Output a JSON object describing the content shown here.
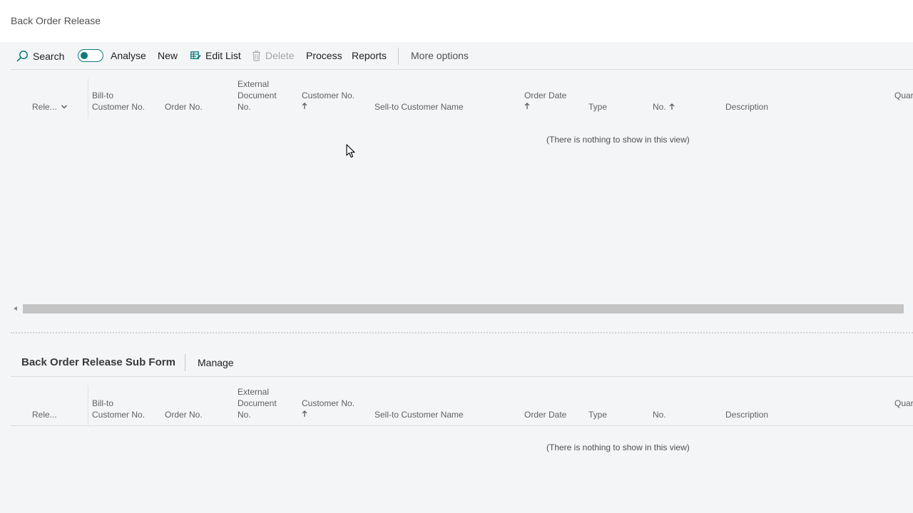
{
  "page": {
    "title": "Back Order Release"
  },
  "actions": {
    "search": "Search",
    "analyse": "Analyse",
    "new": "New",
    "edit_list": "Edit List",
    "delete": "Delete",
    "process": "Process",
    "reports": "Reports",
    "more_options": "More options"
  },
  "main_grid": {
    "columns": {
      "released": "Rele...",
      "bill_to_line1": "Bill-to",
      "bill_to_line2": "Customer No.",
      "order_no": "Order No.",
      "ext_doc_line1": "External",
      "ext_doc_line2": "Document",
      "ext_doc_line3": "No.",
      "customer_no": "Customer No.",
      "sell_to_name": "Sell-to Customer Name",
      "order_date": "Order Date",
      "type": "Type",
      "no": "No.",
      "description": "Description",
      "quantity": "Quar"
    },
    "empty_message": "(There is nothing to show in this view)"
  },
  "subform": {
    "title": "Back Order Release Sub Form",
    "manage": "Manage",
    "columns": {
      "released": "Rele...",
      "bill_to_line1": "Bill-to",
      "bill_to_line2": "Customer No.",
      "order_no": "Order No.",
      "ext_doc_line1": "External",
      "ext_doc_line2": "Document",
      "ext_doc_line3": "No.",
      "customer_no": "Customer No.",
      "sell_to_name": "Sell-to Customer Name",
      "order_date": "Order Date",
      "type": "Type",
      "no": "No.",
      "description": "Description",
      "quantity": "Quar"
    },
    "empty_message": "(There is nothing to show in this view)"
  },
  "icons": {
    "search": "search-icon",
    "edit_list": "edit-list-icon",
    "delete": "trash-icon",
    "sort_ascending": "arrow-up-icon",
    "filter_menu": "chevron-down-icon",
    "cursor": "mouse-pointer-icon"
  },
  "colors": {
    "accent": "#0e7a7a",
    "background": "#f4f5f7",
    "disabled": "#a6a6a6"
  }
}
